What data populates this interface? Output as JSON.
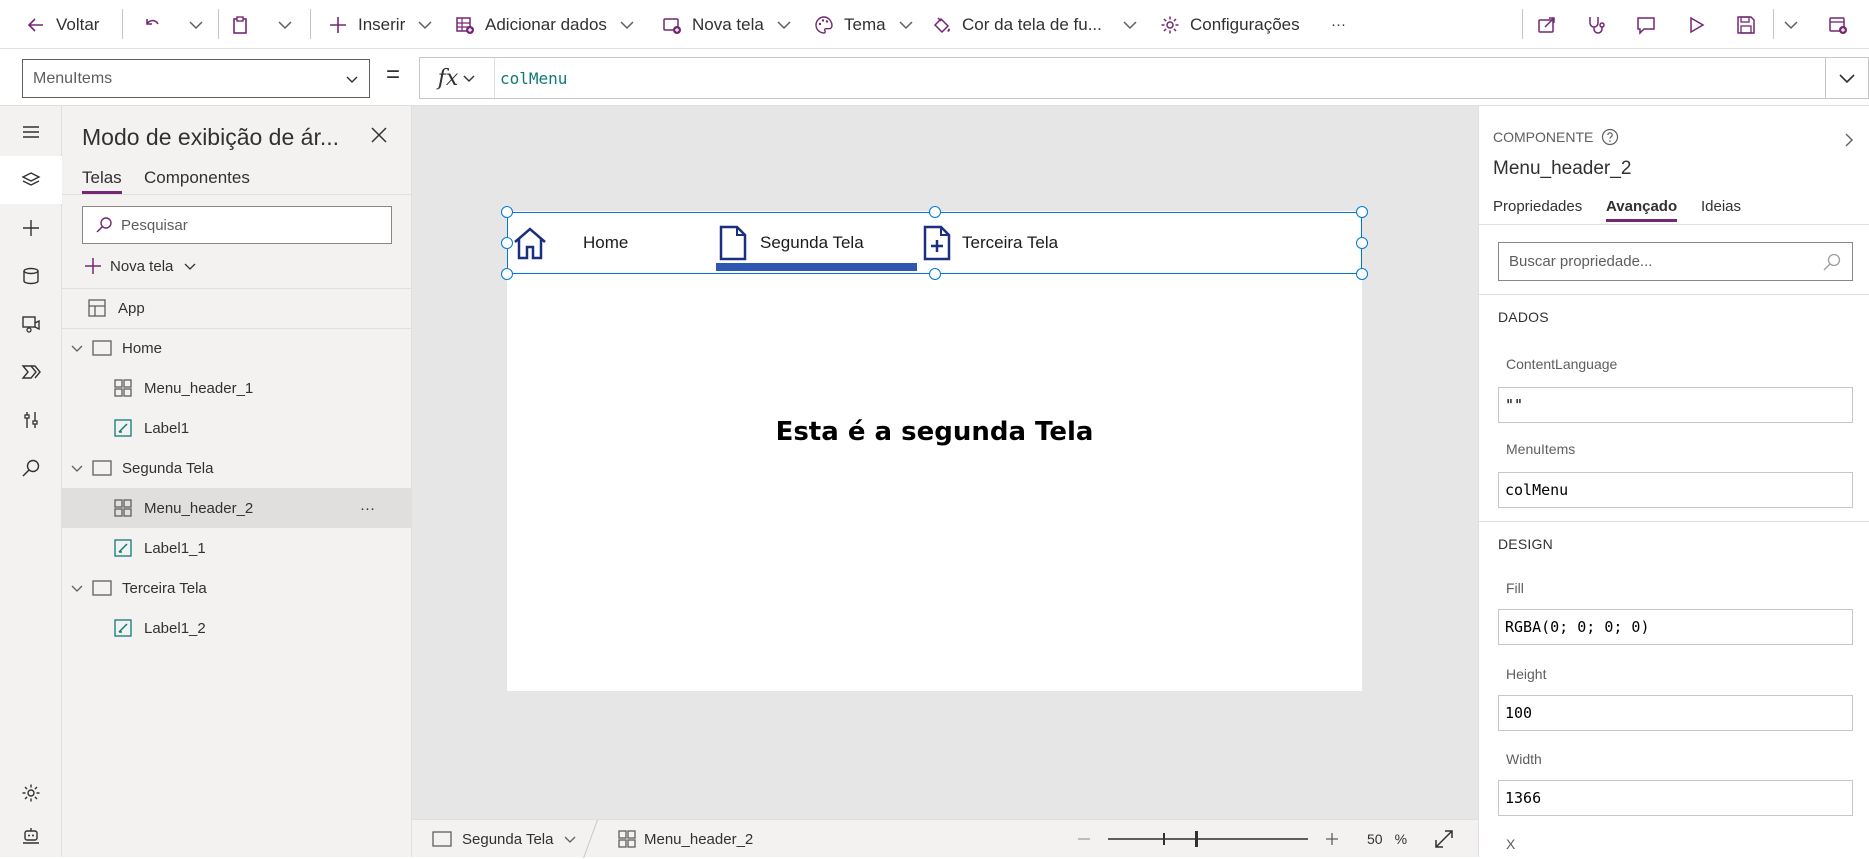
{
  "toolbar": {
    "back_label": "Voltar",
    "insert_label": "Inserir",
    "add_data_label": "Adicionar dados",
    "new_screen_label": "Nova tela",
    "theme_label": "Tema",
    "background_label": "Cor da tela de fu...",
    "settings_label": "Configurações",
    "more_label": "···"
  },
  "formula": {
    "property": "MenuItems",
    "equals": "=",
    "fx": "fx",
    "value": "colMenu"
  },
  "tree": {
    "title": "Modo de exibição de ár...",
    "tabs": [
      "Telas",
      "Componentes"
    ],
    "search_placeholder": "Pesquisar",
    "new_screen": "Nova tela",
    "items": [
      {
        "label": "App",
        "type": "app"
      },
      {
        "label": "Home",
        "type": "screen"
      },
      {
        "label": "Menu_header_1",
        "type": "component"
      },
      {
        "label": "Label1",
        "type": "label"
      },
      {
        "label": "Segunda Tela",
        "type": "screen"
      },
      {
        "label": "Menu_header_2",
        "type": "component",
        "selected": true
      },
      {
        "label": "Label1_1",
        "type": "label"
      },
      {
        "label": "Terceira Tela",
        "type": "screen"
      },
      {
        "label": "Label1_2",
        "type": "label"
      }
    ],
    "more": "···"
  },
  "canvas": {
    "menu_items": [
      "Home",
      "Segunda Tela",
      "Terceira Tela"
    ],
    "selected_menu": "Segunda Tela",
    "screen_text": "Esta é a segunda Tela"
  },
  "status": {
    "screen": "Segunda Tela",
    "component": "Menu_header_2",
    "zoom": "50",
    "zoom_unit": "%",
    "zoom_level": 0.5
  },
  "properties": {
    "type_label": "COMPONENTE",
    "name": "Menu_header_2",
    "tabs": [
      "Propriedades",
      "Avançado",
      "Ideias"
    ],
    "active_tab": "Avançado",
    "search_placeholder": "Buscar propriedade...",
    "sections": {
      "data": "DADOS",
      "design": "DESIGN"
    },
    "fields": {
      "content_language_label": "ContentLanguage",
      "content_language_value": "\"\"",
      "menu_items_label": "MenuItems",
      "menu_items_value": "colMenu",
      "fill_label": "Fill",
      "fill_value": "RGBA(0; 0; 0; 0)",
      "height_label": "Height",
      "height_value": "100",
      "width_label": "Width",
      "width_value": "1366",
      "x_label": "X"
    }
  },
  "colors": {
    "accent": "#742774",
    "selection": "#0078d4",
    "menu_indicator": "#2f56b0",
    "formula_text": "#0f7b74"
  }
}
